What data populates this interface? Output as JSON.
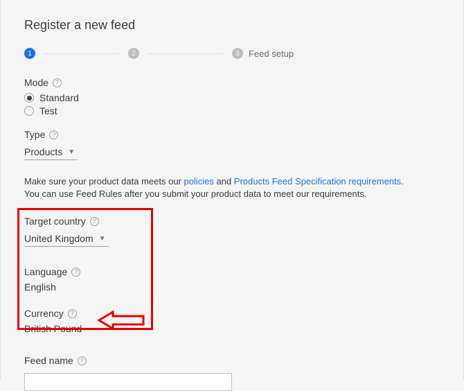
{
  "page_title": "Register a new feed",
  "stepper": {
    "step1": "1",
    "step2": "2",
    "step3": "3",
    "step3_label": "Feed setup"
  },
  "mode": {
    "label": "Mode",
    "option_standard": "Standard",
    "option_test": "Test"
  },
  "type": {
    "label": "Type",
    "value": "Products"
  },
  "info": {
    "pre": "Make sure your product data meets our ",
    "policies": "policies",
    "and": " and ",
    "spec": "Products Feed Specification requirements",
    "dot": ".",
    "line2": "You can use Feed Rules after you submit your product data to meet our requirements."
  },
  "country": {
    "label": "Target country",
    "value": "United Kingdom"
  },
  "language": {
    "label": "Language",
    "value": "English"
  },
  "currency": {
    "label": "Currency",
    "value": "British Pound"
  },
  "feedname": {
    "label": "Feed name",
    "value": ""
  }
}
